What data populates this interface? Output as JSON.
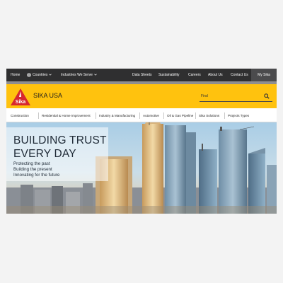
{
  "topnav": {
    "home": "Home",
    "countries": "Countries",
    "industries": "Industries We Serve",
    "data_sheets": "Data Sheets",
    "sustainability": "Sustainability",
    "careers": "Careers",
    "about": "About Us",
    "contact": "Contact Us",
    "my_sika": "My Sika"
  },
  "header": {
    "logo_text": "Sika",
    "brand": "SIKA USA",
    "search_placeholder": "Find"
  },
  "categories": [
    "Construction",
    "Residential & Home Improvement",
    "Industry & Manufacturing",
    "Automotive",
    "Oil & Gas Pipeline",
    "Sika Solutions",
    "Projects Types"
  ],
  "hero": {
    "title_line1": "BUILDING TRUST",
    "title_line2": "EVERY DAY",
    "tagline1": "Protecting the past",
    "tagline2": "Building the present",
    "tagline3": "Innovating for the future"
  },
  "colors": {
    "brand_yellow": "#ffc20e",
    "brand_red": "#d7282f",
    "nav_dark": "#2f2f30"
  }
}
